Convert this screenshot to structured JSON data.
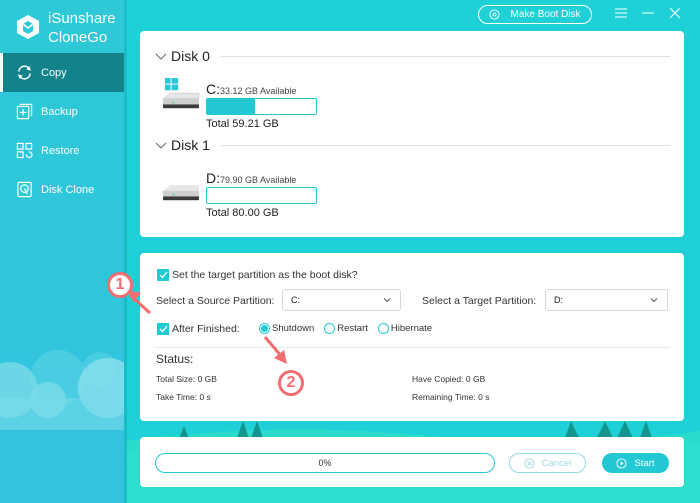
{
  "app": {
    "brand_line1": "iSunshare",
    "brand_line2": "CloneGo"
  },
  "sidebar": {
    "items": [
      {
        "label": "Copy",
        "icon": "sync-icon",
        "active": true
      },
      {
        "label": "Backup",
        "icon": "backup-icon",
        "active": false
      },
      {
        "label": "Restore",
        "icon": "restore-icon",
        "active": false
      },
      {
        "label": "Disk Clone",
        "icon": "disk-clone-icon",
        "active": false
      }
    ]
  },
  "topbar": {
    "make_boot_disk_label": "Make Boot Disk"
  },
  "disks": [
    {
      "title": "Disk 0",
      "partition": {
        "letter": "C:",
        "available": "33.12 GB Available",
        "total": "Total 59.21 GB",
        "used_fraction": 0.44,
        "system": true
      }
    },
    {
      "title": "Disk 1",
      "partition": {
        "letter": "D:",
        "available": "79.90 GB Available",
        "total": "Total 80.00 GB",
        "used_fraction": 0.0,
        "system": false
      }
    }
  ],
  "options": {
    "boot_disk_label": "Set the target partition as the boot disk?",
    "boot_disk_checked": true,
    "source_label": "Select a Source Partition:",
    "source_value": "C:",
    "target_label": "Select a Target Partition:",
    "target_value": "D:",
    "after_finished_label": "After Finished:",
    "after_finished_checked": true,
    "after_actions": [
      {
        "label": "Shutdown",
        "selected": true
      },
      {
        "label": "Restart",
        "selected": false
      },
      {
        "label": "Hibernate",
        "selected": false
      }
    ]
  },
  "status": {
    "title": "Status:",
    "total_size": "Total Size: 0 GB",
    "have_copied": "Have Copied: 0 GB",
    "take_time": "Take Time: 0 s",
    "remaining_time": "Remaining Time: 0 s"
  },
  "progress": {
    "percent_label": "0%",
    "value": 0
  },
  "actions": {
    "cancel_label": "Cancel",
    "start_label": "Start"
  },
  "callouts": [
    {
      "label": "1"
    },
    {
      "label": "2"
    }
  ],
  "colors": {
    "accent": "#22c9d3",
    "sidebar_active": "#12838a",
    "callout": "#f06d72"
  }
}
